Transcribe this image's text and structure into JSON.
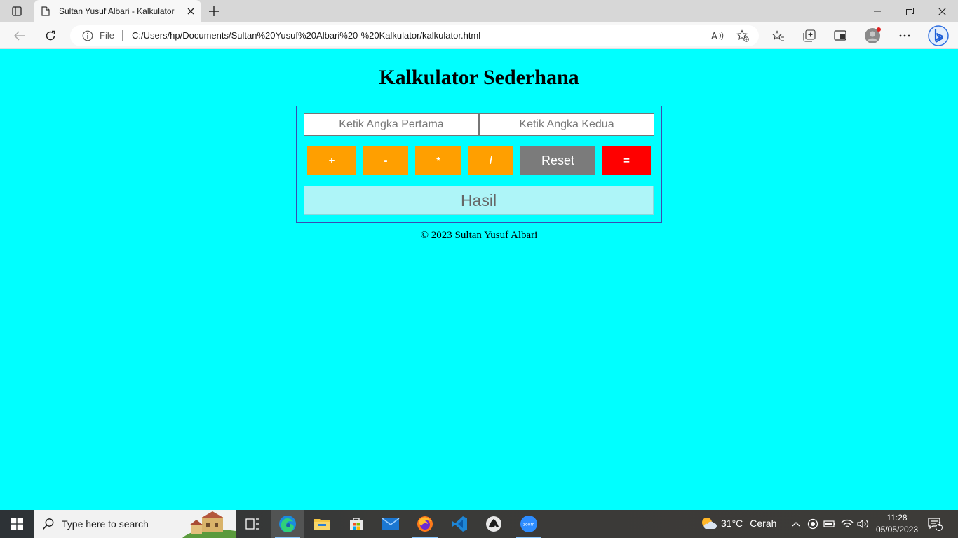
{
  "browser": {
    "tab_title": "Sultan Yusuf Albari - Kalkulator",
    "file_label": "File",
    "url": "C:/Users/hp/Documents/Sultan%20Yusuf%20Albari%20-%20Kalkulator/kalkulator.html"
  },
  "page": {
    "title": "Kalkulator Sederhana",
    "first_placeholder": "Ketik Angka Pertama",
    "second_placeholder": "Ketik Angka Kedua",
    "buttons": {
      "add": "+",
      "subtract": "-",
      "multiply": "*",
      "divide": "/",
      "reset": "Reset",
      "equals": "="
    },
    "result_placeholder": "Hasil",
    "footer": "© 2023 Sultan Yusuf Albari",
    "colors": {
      "background": "#00ffff",
      "operator": "#ff9f00",
      "reset": "#7b7b7b",
      "equals": "#ff0000",
      "result_bg": "#aef5f8",
      "border": "#3a4db3"
    }
  },
  "taskbar": {
    "search_placeholder": "Type here to search",
    "weather_temp": "31°C",
    "weather_desc": "Cerah",
    "time": "11:28",
    "date": "05/05/2023",
    "notification_count": "1",
    "apps": [
      "task-view-icon",
      "edge-icon",
      "file-explorer-icon",
      "microsoft-store-icon",
      "mail-icon",
      "firefox-icon",
      "vscode-icon",
      "inkscape-icon",
      "zoom-icon"
    ]
  }
}
